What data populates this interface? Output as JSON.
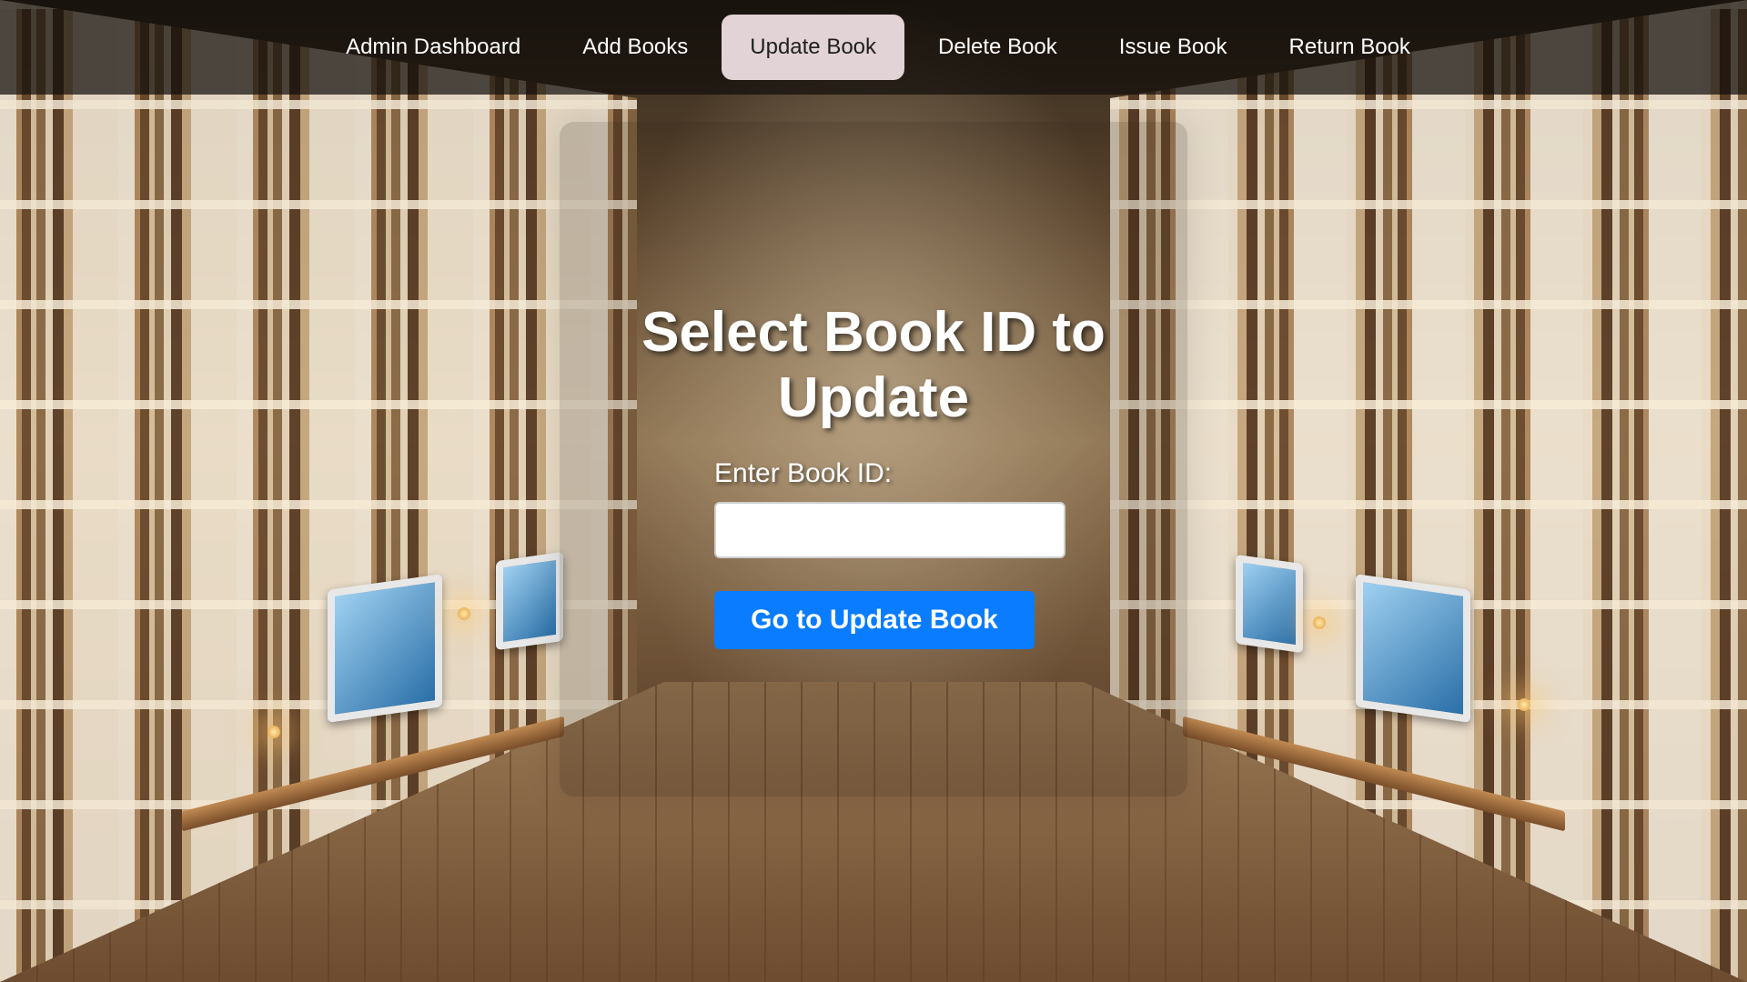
{
  "nav": {
    "items": [
      {
        "label": "Admin Dashboard",
        "active": false
      },
      {
        "label": "Add Books",
        "active": false
      },
      {
        "label": "Update Book",
        "active": true
      },
      {
        "label": "Delete Book",
        "active": false
      },
      {
        "label": "Issue Book",
        "active": false
      },
      {
        "label": "Return Book",
        "active": false
      }
    ],
    "active_bg_color": "#e2d3d6"
  },
  "form": {
    "title": "Select Book ID to Update",
    "field_label": "Enter Book ID:",
    "field_value": "",
    "field_placeholder": "",
    "submit_label": "Go to Update Book",
    "submit_color": "#0a7cff"
  }
}
